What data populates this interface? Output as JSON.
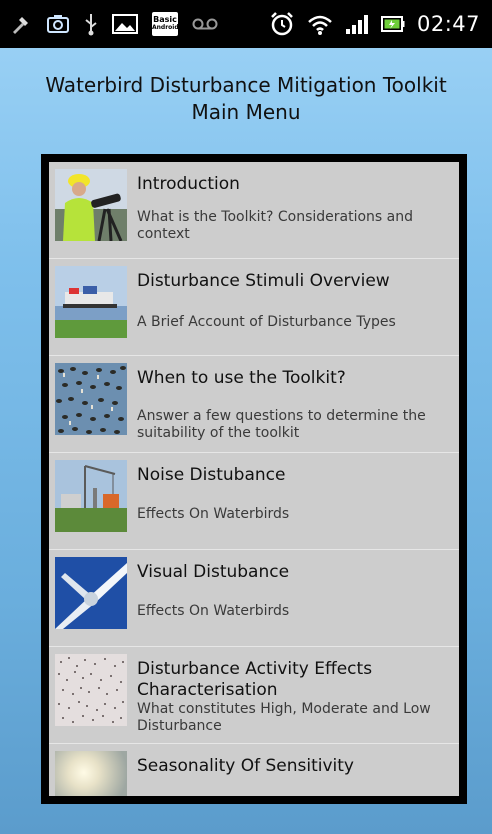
{
  "status_bar": {
    "time": "02:47",
    "basic_badge_line1": "Basic",
    "basic_badge_line2": "Android",
    "left_icons": [
      "tools-icon",
      "camera-icon",
      "usb-icon",
      "image-icon",
      "basic-android-icon",
      "voicemail-icon"
    ],
    "right_icons": [
      "alarm-icon",
      "wifi-icon",
      "signal-icon",
      "battery-icon"
    ]
  },
  "header": {
    "title_line1": "Waterbird Disturbance Mitigation Toolkit",
    "title_line2": "Main Menu"
  },
  "menu": {
    "items": [
      {
        "title": "Introduction",
        "subtitle": "What is the Toolkit? Considerations and context",
        "thumb": "person-with-telescope-thumb"
      },
      {
        "title": "Disturbance Stimuli Overview",
        "subtitle": "A Brief Account of Disturbance Types",
        "thumb": "ship-on-river-thumb"
      },
      {
        "title": "When to use the Toolkit?",
        "subtitle": "Answer a few questions to determine the suitability of the toolkit",
        "thumb": "flock-on-water-thumb"
      },
      {
        "title": "Noise Distubance",
        "subtitle": "Effects On Waterbirds",
        "thumb": "construction-crane-thumb"
      },
      {
        "title": "Visual Distubance",
        "subtitle": "Effects On Waterbirds",
        "thumb": "wind-turbine-thumb"
      },
      {
        "title": "Disturbance Activity Effects Characterisation",
        "subtitle": "What constitutes High, Moderate and Low Disturbance",
        "thumb": "flying-flock-thumb"
      },
      {
        "title": "Seasonality Of Sensitivity",
        "subtitle": "",
        "thumb": "hazy-sun-thumb"
      }
    ]
  }
}
